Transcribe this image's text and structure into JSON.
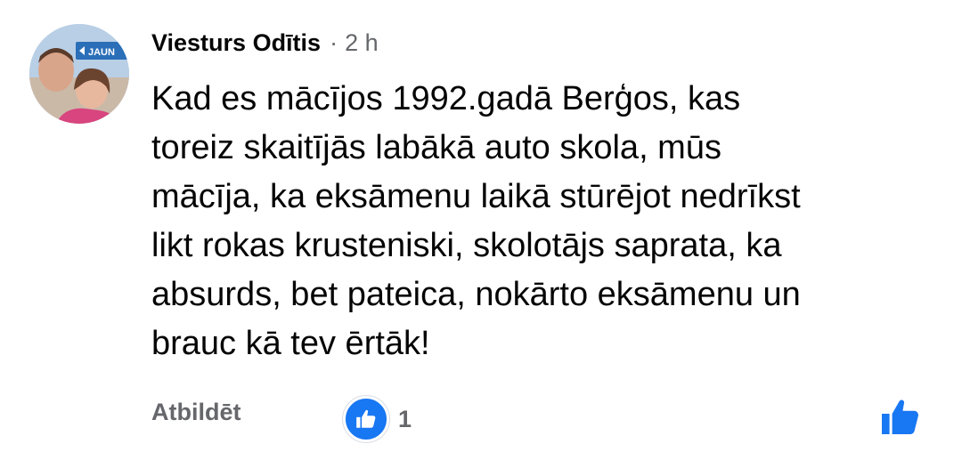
{
  "comment": {
    "author": "Viesturs Odītis",
    "separator": "·",
    "time": "2 h",
    "text_lines": [
      "Kad es mācījos 1992.gadā Berģos, kas",
      "toreiz skaitījās labākā auto skola, mūs",
      "mācīja, ka eksāmenu laikā stūrējot nedrīkst",
      "likt rokas krusteniski, skolotājs saprata, ka",
      "absurds, bet pateica, nokārto eksāmenu un",
      "brauc kā tev ērtāk!"
    ],
    "avatar_sign_text": "JAUN"
  },
  "actions": {
    "reply_label": "Atbildēt",
    "reaction_count": "1",
    "reaction_icon": "like-icon",
    "like_button_icon": "thumbs-up-icon"
  },
  "colors": {
    "text": "#050505",
    "secondary": "#65676b",
    "accent": "#1877f2"
  }
}
